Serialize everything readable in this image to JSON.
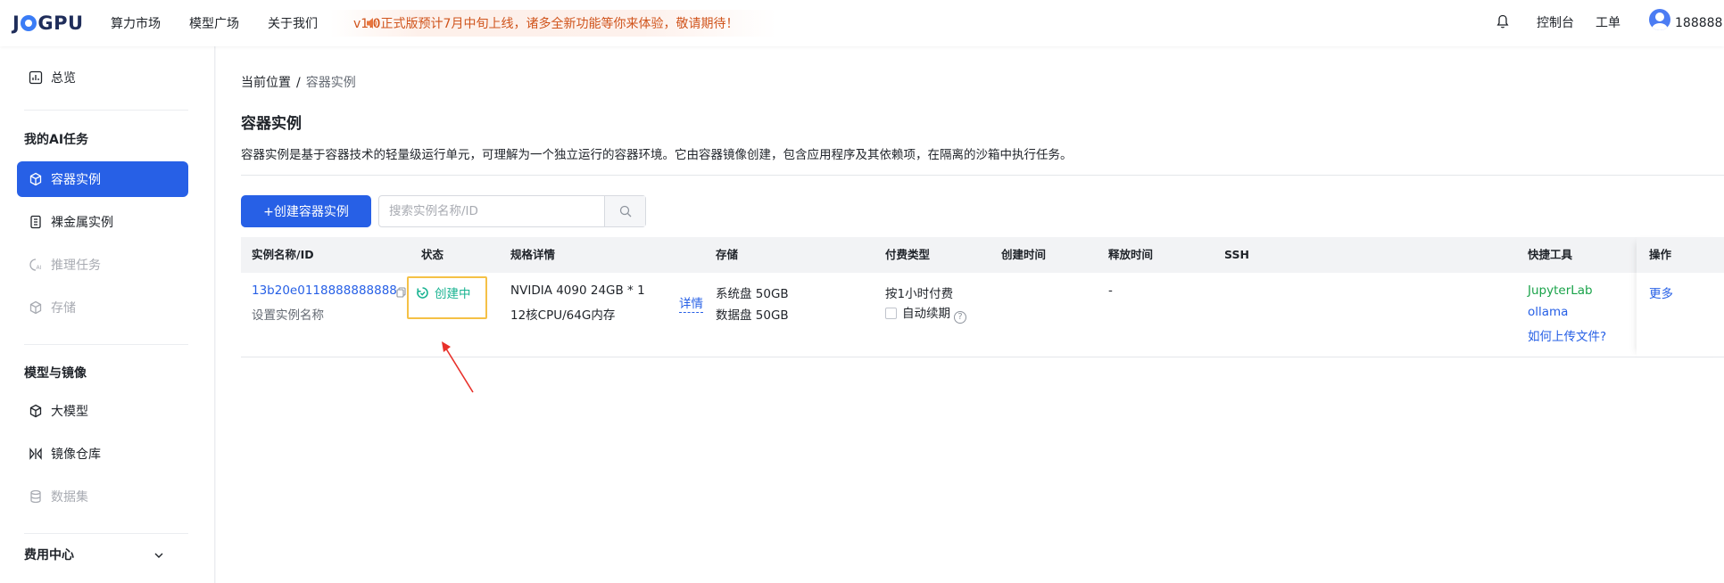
{
  "brand": {
    "logo_text": "JOGPU"
  },
  "topnav": {
    "items": [
      "算力市场",
      "模型广场",
      "关于我们"
    ],
    "notice": "v1.0正式版预计7月中旬上线，诸多全新功能等你来体验，敬请期待！",
    "console": "控制台",
    "ticket": "工单",
    "user": "188888..."
  },
  "sidebar": {
    "overview": "总览",
    "group_ai": "我的AI任务",
    "container": "容器实例",
    "baremetal": "裸金属实例",
    "inference": "推理任务",
    "storage": "存储",
    "group_model": "模型与镜像",
    "llm": "大模型",
    "registry": "镜像仓库",
    "dataset": "数据集",
    "group_fee": "费用中心"
  },
  "main": {
    "breadcrumb_prefix": "当前位置",
    "breadcrumb_sep": "/",
    "breadcrumb_current": "容器实例",
    "title": "容器实例",
    "description": "容器实例是基于容器技术的轻量级运行单元，可理解为一个独立运行的容器环境。它由容器镜像创建，包含应用程序及其依赖项，在隔离的沙箱中执行任务。",
    "create_button": "+创建容器实例",
    "search_placeholder": "搜索实例名称/ID"
  },
  "table": {
    "headers": {
      "name": "实例名称/ID",
      "status": "状态",
      "spec": "规格详情",
      "storage": "存储",
      "billing": "付费类型",
      "created": "创建时间",
      "release": "释放时间",
      "ssh": "SSH",
      "tools": "快捷工具",
      "ops": "操作"
    },
    "rows": [
      {
        "id": "13b20e0118888888888",
        "name_hint": "设置实例名称",
        "status": "创建中",
        "spec_line1": "NVIDIA 4090 24GB * 1",
        "spec_line2": "12核CPU/64G内存",
        "spec_link": "详情",
        "storage_sys": "系统盘 50GB",
        "storage_data": "数据盘 50GB",
        "billing": "按1小时付费",
        "auto_renew": "自动续期",
        "created": "",
        "release": "-",
        "ssh": "",
        "tool1": "JupyterLab",
        "tool2": "ollama",
        "tool3": "如何上传文件?",
        "op": "更多"
      }
    ]
  },
  "colors": {
    "primary": "#2760e6",
    "status_green": "#19b391",
    "highlight": "#f5c146",
    "arrow": "#e8302a"
  }
}
